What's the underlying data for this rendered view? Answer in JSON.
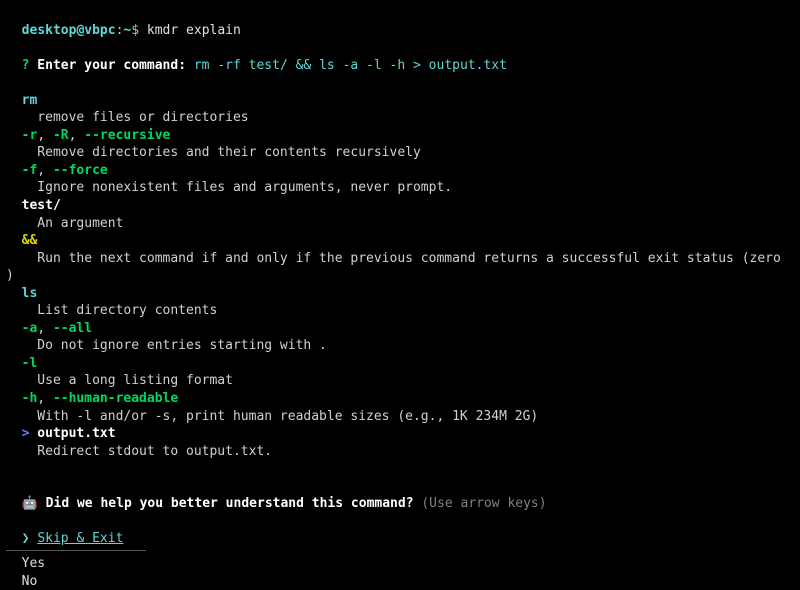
{
  "prompt": {
    "user": "desktop",
    "at": "@",
    "host": "vbpc",
    "colon": ":",
    "tilde": "~",
    "dollar": "$ ",
    "typed": "kmdr explain"
  },
  "enter": {
    "qmark": "?",
    "label": " Enter your command: ",
    "value": "rm -rf test/ && ls -a -l -h > output.txt"
  },
  "explain": [
    {
      "kind": "cmd",
      "token": "rm",
      "desc": "remove files or directories"
    },
    {
      "kind": "opt3",
      "t1": "-r",
      "t2": "-R",
      "t3": "--recursive",
      "desc": "Remove directories and their contents recursively"
    },
    {
      "kind": "opt2",
      "t1": "-f",
      "t2": "--force",
      "desc": "Ignore nonexistent files and arguments, never prompt."
    },
    {
      "kind": "arg",
      "token": "test/",
      "desc": "An argument"
    },
    {
      "kind": "op",
      "token": "&&",
      "desc": "Run the next command if and only if the previous command returns a successful exit status (zero",
      "tail": ")"
    },
    {
      "kind": "cmd",
      "token": "ls",
      "desc": "List directory contents"
    },
    {
      "kind": "opt2",
      "t1": "-a",
      "t2": "--all",
      "desc": "Do not ignore entries starting with ."
    },
    {
      "kind": "opt1",
      "t1": "-l",
      "desc": "Use a long listing format"
    },
    {
      "kind": "opt2",
      "t1": "-h",
      "t2": "--human-readable",
      "desc": "With -l and/or -s, print human readable sizes (e.g., 1K 234M 2G)"
    },
    {
      "kind": "redir",
      "sym": ">",
      "target": "output.txt",
      "desc": "Redirect stdout to output.txt."
    }
  ],
  "feedback": {
    "icon": "🤖",
    "question": "Did we help you better understand this command?",
    "hint": " (Use arrow keys)",
    "caret": "❯ ",
    "selected": "Skip & Exit",
    "options": [
      "Yes",
      "No"
    ]
  },
  "sep": ", "
}
